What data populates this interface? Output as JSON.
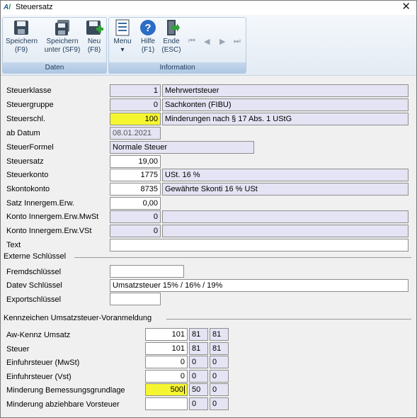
{
  "window": {
    "title": "Steuersatz",
    "app_logo": "AL",
    "close_glyph": "✕"
  },
  "ribbon": {
    "groups": [
      {
        "label": "Daten"
      },
      {
        "label": "Information"
      }
    ],
    "buttons": {
      "save": {
        "line1": "Speichern",
        "line2": "(F9)"
      },
      "save_under": {
        "line1": "Speichern",
        "line2": "unter (SF9)"
      },
      "new": {
        "line1": "Neu",
        "line2": "(F8)"
      },
      "menu": {
        "line1": "Menu",
        "line2": "▾"
      },
      "help": {
        "line1": "Hilfe",
        "line2": "(F1)"
      },
      "exit": {
        "line1": "Ende",
        "line2": "(ESC)"
      }
    },
    "nav": {
      "first": "⏮",
      "prev": "◀",
      "next": "▶",
      "last": "⏭"
    }
  },
  "fields": {
    "steuerklasse": {
      "label": "Steuerklasse",
      "value": "1",
      "desc": "Mehrwertsteuer"
    },
    "steuergruppe": {
      "label": "Steuergruppe",
      "value": "0",
      "desc": "Sachkonten (FIBU)"
    },
    "steuerschl": {
      "label": "Steuerschl.",
      "value": "100",
      "desc": "Minderungen nach § 17 Abs. 1 UStG"
    },
    "ab_datum": {
      "label": "ab Datum",
      "value": "08.01.2021"
    },
    "steuerformel": {
      "label": "SteuerFormel",
      "value": "Normale Steuer"
    },
    "steuersatz": {
      "label": "Steuersatz",
      "value": "19,00"
    },
    "steuerkonto": {
      "label": "Steuerkonto",
      "value": "1775",
      "desc": "USt. 16 %"
    },
    "skontokonto": {
      "label": "Skontokonto",
      "value": "8735",
      "desc": "Gewährte Skonti 16 % USt"
    },
    "satz_innergem": {
      "label": "Satz Innergem.Erw.",
      "value": "0,00"
    },
    "konto_innergem_mwst": {
      "label": "Konto Innergem.Erw.MwSt",
      "value": "0",
      "desc": ""
    },
    "konto_innergem_vst": {
      "label": "Konto Innergem.Erw.VSt",
      "value": "0",
      "desc": ""
    },
    "text": {
      "label": "Text",
      "value": ""
    }
  },
  "externe": {
    "title": "Externe Schlüssel",
    "fremd": {
      "label": "Fremdschlüssel",
      "value": ""
    },
    "datev": {
      "label": "Datev Schlüssel",
      "value": "Umsatzsteuer 15% / 16% / 19%"
    },
    "export": {
      "label": "Exportschlüssel",
      "value": ""
    }
  },
  "kennzeichen": {
    "title": "Kennzeichen Umsatzsteuer-Voranmeldung",
    "rows": [
      {
        "label": "Aw-Kennz Umsatz",
        "value": "101",
        "c2": "81",
        "c3": "81"
      },
      {
        "label": "Steuer",
        "value": "101",
        "c2": "81",
        "c3": "81"
      },
      {
        "label": "Einfuhrsteuer (MwSt)",
        "value": "0",
        "c2": "0",
        "c3": "0"
      },
      {
        "label": "Einfuhrsteuer (Vst)",
        "value": "0",
        "c2": "0",
        "c3": "0"
      },
      {
        "label": "Minderung Bemessungsgrundlage",
        "value": "500",
        "c2": "50",
        "c3": "0"
      },
      {
        "label": "Minderung abziehbare Vorsteuer",
        "value": "",
        "c2": "0",
        "c3": "0"
      }
    ]
  },
  "colors": {
    "highlight": "#f6f630",
    "readonly": "#e4e4f4",
    "ribbon": "#dfe8f2"
  }
}
